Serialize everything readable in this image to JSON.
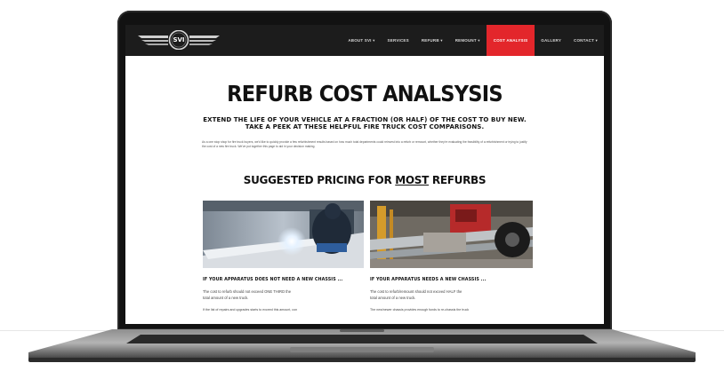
{
  "nav": {
    "logo_text": "SVI",
    "items": [
      {
        "label": "ABOUT SVI ▾",
        "active": false
      },
      {
        "label": "SERVICES",
        "active": false
      },
      {
        "label": "REFURB ▾",
        "active": false
      },
      {
        "label": "REMOUNT ▾",
        "active": false
      },
      {
        "label": "COST ANALYSIS",
        "active": true
      },
      {
        "label": "GALLERY",
        "active": false
      },
      {
        "label": "CONTACT ▾",
        "active": false
      }
    ]
  },
  "page": {
    "title": "REFURB COST ANALSYSIS",
    "subtitle_line1": "EXTEND THE LIFE OF YOUR VEHICLE AT A FRACTION (OR HALF) OF THE COST TO BUY NEW.",
    "subtitle_line2": "TAKE A PEEK AT THESE HELPFUL FIRE TRUCK COST COMPARISONS.",
    "intro": "As a one stop shop for fire truck buyers, we'd like to quickly provide a few refurbishment results based on how much total departments could reinvest into a refurb or remount, whether they're evaluating the feasibility of a refurbishment or trying to justify the cost of a new fire truck. We've put together this page to aid in your decision making.",
    "pricing_heading_pre": "SUGGESTED PRICING FOR ",
    "pricing_heading_emph": "MOST",
    "pricing_heading_post": " REFURBS"
  },
  "cards": [
    {
      "heading": "IF YOUR APPARATUS DOES NOT NEED A NEW CHASSIS ...",
      "line1": "The cost to refurb should not exceed ONE THIRD the",
      "line2": "total amount of a new truck.",
      "line3": "If the list of repairs and upgrades starts to exceed this amount, con"
    },
    {
      "heading": "IF YOUR APPARATUS NEEDS A NEW CHASSIS ...",
      "line1": "The cost to refurb/remount should not exceed HALF the",
      "line2": "total amount of a new truck.",
      "line3": "The new/newer chassis provides enough funds to re-chassis the truck"
    }
  ],
  "colors": {
    "nav_background": "#1c1c1c",
    "active_nav": "#e3262b",
    "heading_text": "#111111"
  }
}
